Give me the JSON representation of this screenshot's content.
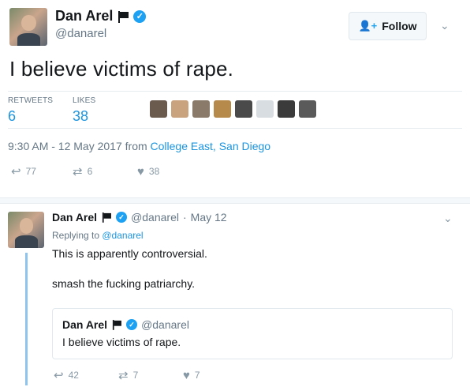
{
  "main_tweet": {
    "author_name": "Dan Arel",
    "handle": "@danarel",
    "follow_label": "Follow",
    "text": "I believe victims of rape.",
    "retweets_label": "RETWEETS",
    "retweets_count": "6",
    "likes_label": "LIKES",
    "likes_count": "38",
    "timestamp": "9:30 AM - 12 May 2017 from ",
    "location": "College East, San Diego",
    "reply_count": "77",
    "retweet_action_count": "6",
    "like_action_count": "38"
  },
  "reply_tweet": {
    "author_name": "Dan Arel",
    "handle": "@danarel",
    "dot": "·",
    "date": "May 12",
    "replying_to_prefix": "Replying to ",
    "replying_to_handle": "@danarel",
    "line1": "This is apparently controversial.",
    "line2": "smash the fucking patriarchy.",
    "quoted": {
      "author_name": "Dan Arel",
      "handle": "@danarel",
      "text": "I believe victims of rape."
    },
    "reply_count": "42",
    "retweet_count": "7",
    "like_count": "7"
  },
  "colors": {
    "accent": "#1da1f2",
    "link": "#1b95e0",
    "muted": "#657786",
    "thread": "#8ec4ec"
  },
  "icons": [
    "reply-icon",
    "retweet-icon",
    "heart-icon",
    "verified-icon",
    "flag-icon",
    "follow-person-icon",
    "chevron-down-icon"
  ]
}
